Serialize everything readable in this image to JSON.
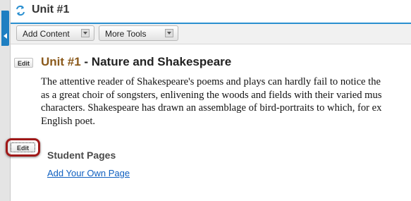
{
  "header": {
    "title": "Unit #1"
  },
  "toolbar": {
    "add_content_label": "Add Content",
    "more_tools_label": "More Tools"
  },
  "unit": {
    "edit_label": "Edit",
    "number": "Unit #1",
    "title_rest": " - Nature and Shakespeare",
    "intro_lines": [
      "The attentive reader of Shakespeare's poems and plays can hardly fail to notice the",
      "as a great choir of songsters, enlivening the woods and fields with their varied mus",
      "characters. Shakespeare has drawn an assemblage of bird-portraits to which, for ex",
      "English poet."
    ]
  },
  "student_pages": {
    "edit_label": "Edit",
    "heading": "Student Pages",
    "add_link": "Add Your Own Page"
  },
  "colors": {
    "accent_blue": "#2a8fd0",
    "unit_number_brown": "#8b5a1c",
    "highlight_red": "#a01818",
    "link_blue": "#1060c0"
  }
}
